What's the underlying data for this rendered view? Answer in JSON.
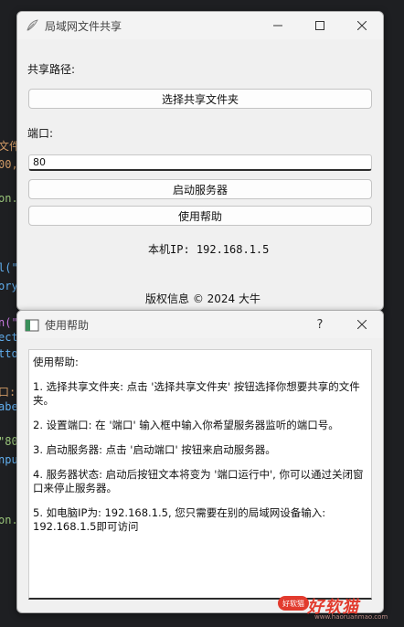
{
  "background_code": {
    "lines": [
      "文件共",
      "00,",
      "on.",
      "l(\"",
      "ory",
      "n(\"",
      "ect",
      "tto",
      "口:",
      "abe",
      "\"80",
      "npu",
      "on."
    ]
  },
  "main_window": {
    "title": "局域网文件共享",
    "share_path_label": "共享路径:",
    "select_folder_button": "选择共享文件夹",
    "port_label": "端口:",
    "port_value": "80",
    "start_server_button": "启动服务器",
    "help_button": "使用帮助",
    "local_ip": "本机IP: 192.168.1.5",
    "copyright": "版权信息 © 2024 大牛"
  },
  "help_dialog": {
    "title": "使用帮助",
    "question_mark": "?",
    "heading": "使用帮助:",
    "items": [
      "1. 选择共享文件夹: 点击 '选择共享文件夹' 按钮选择你想要共享的文件夹。",
      "2. 设置端口: 在 '端口' 输入框中输入你希望服务器监听的端口号。",
      "3. 启动服务器: 点击 '启动端口' 按钮来启动服务器。",
      "4. 服务器状态: 启动后按钮文本将变为 '端口运行中', 你可以通过关闭窗口来停止服务器。",
      "5. 如电脑IP为: 192.168.1.5, 您只需要在别的局域网设备输入: 192.168.1.5即可访问"
    ]
  },
  "watermark": {
    "badge": "好软猫",
    "text": "好软猫",
    "url": "www.haoruanmao.com"
  }
}
